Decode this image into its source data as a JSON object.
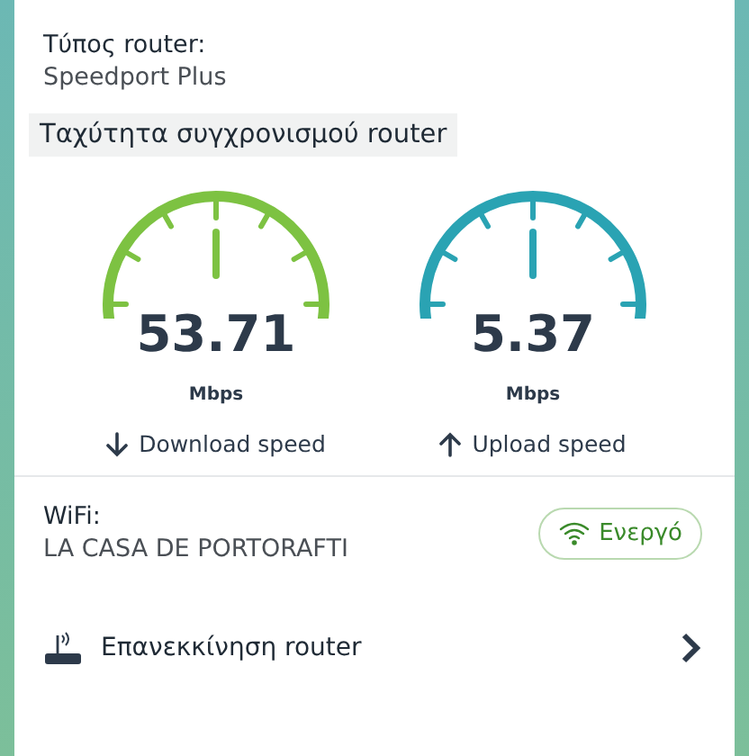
{
  "router_type": {
    "label": "Τύπος router:",
    "value": "Speedport Plus"
  },
  "sync_speed": {
    "title": "Ταχύτητα συγχρονισμού router",
    "gauges": [
      {
        "kind": "download",
        "value": "53.71",
        "unit": "Mbps",
        "label": "Download speed",
        "color": "#7dc242"
      },
      {
        "kind": "upload",
        "value": "5.37",
        "unit": "Mbps",
        "label": "Upload speed",
        "color": "#2aa3b3"
      }
    ]
  },
  "wifi": {
    "label": "WiFi:",
    "value": "LA CASA DE PORTORAFTI",
    "status": "Ενεργό"
  },
  "restart": {
    "label": "Επανεκκίνηση router"
  }
}
